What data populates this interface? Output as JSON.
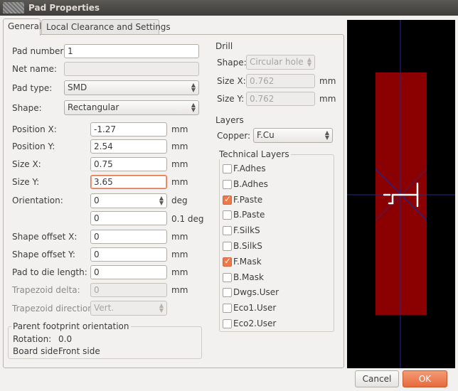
{
  "window": {
    "title": "Pad Properties"
  },
  "tabs": [
    {
      "label": "General",
      "active": true
    },
    {
      "label": "Local Clearance and Settings",
      "active": false
    }
  ],
  "general": {
    "pad_number": {
      "label": "Pad number:",
      "value": "1"
    },
    "net_name": {
      "label": "Net name:",
      "value": ""
    },
    "pad_type": {
      "label": "Pad type:",
      "value": "SMD"
    },
    "shape": {
      "label": "Shape:",
      "value": "Rectangular"
    },
    "position_x": {
      "label": "Position X:",
      "value": "-1.27",
      "unit": "mm"
    },
    "position_y": {
      "label": "Position Y:",
      "value": "2.54",
      "unit": "mm"
    },
    "size_x": {
      "label": "Size X:",
      "value": "0.75",
      "unit": "mm"
    },
    "size_y": {
      "label": "Size Y:",
      "value": "3.65",
      "unit": "mm"
    },
    "orientation": {
      "label": "Orientation:",
      "value": "0",
      "unit": "deg",
      "value2": "0",
      "unit2": "0.1 deg"
    },
    "shape_offset_x": {
      "label": "Shape offset X:",
      "value": "0",
      "unit": "mm"
    },
    "shape_offset_y": {
      "label": "Shape offset Y:",
      "value": "0",
      "unit": "mm"
    },
    "pad_to_die": {
      "label": "Pad to die length:",
      "value": "0",
      "unit": "mm"
    },
    "trapezoid_delta": {
      "label": "Trapezoid delta:",
      "value": "0",
      "unit": "mm"
    },
    "trapezoid_direction": {
      "label": "Trapezoid direction:",
      "value": "Vert."
    }
  },
  "parent_orientation": {
    "title": "Parent footprint orientation",
    "rotation_label": "Rotation:",
    "rotation_value": "0.0",
    "board_side_label": "Board side:",
    "board_side_value": "Front side"
  },
  "drill": {
    "title": "Drill",
    "shape_label": "Shape:",
    "shape_value": "Circular hole",
    "size_x_label": "Size X:",
    "size_x_value": "0.762",
    "size_y_label": "Size Y:",
    "size_y_value": "0.762",
    "unit": "mm"
  },
  "layers": {
    "title": "Layers",
    "copper_label": "Copper:",
    "copper_value": "F.Cu",
    "technical_title": "Technical Layers",
    "items": [
      {
        "label": "F.Adhes",
        "checked": false
      },
      {
        "label": "B.Adhes",
        "checked": false
      },
      {
        "label": "F.Paste",
        "checked": true
      },
      {
        "label": "B.Paste",
        "checked": false
      },
      {
        "label": "F.SilkS",
        "checked": false
      },
      {
        "label": "B.SilkS",
        "checked": false
      },
      {
        "label": "F.Mask",
        "checked": true
      },
      {
        "label": "B.Mask",
        "checked": false
      },
      {
        "label": "Dwgs.User",
        "checked": false
      },
      {
        "label": "Eco1.User",
        "checked": false
      },
      {
        "label": "Eco2.User",
        "checked": false
      }
    ]
  },
  "preview": {
    "pad_label": "1",
    "pad_color": "#8b0000",
    "crosshair_color": "#1f2a8c"
  },
  "buttons": {
    "cancel": "Cancel",
    "ok": "OK"
  }
}
